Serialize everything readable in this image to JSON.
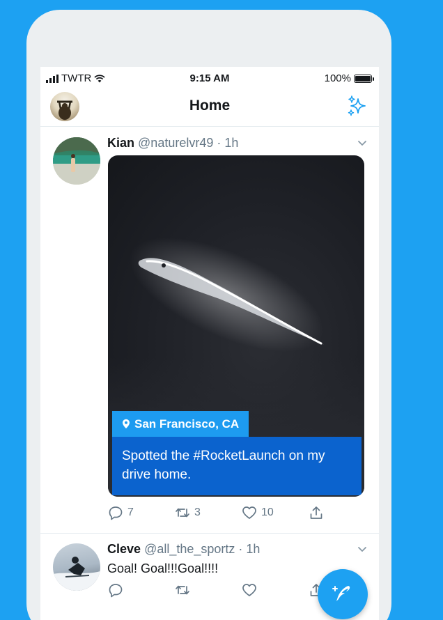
{
  "status_bar": {
    "carrier": "TWTR",
    "time": "9:15 AM",
    "battery": "100%",
    "battery_level": 1.0
  },
  "nav": {
    "title": "Home",
    "left_icon": "profile-avatar",
    "right_icon": "sparkle-icon"
  },
  "tweets": [
    {
      "name": "Kian",
      "handle": "@naturelvr49",
      "time": "· 1h",
      "location": "San Francisco, CA",
      "caption": "Spotted the #RocketLaunch on my drive home.",
      "replies": "7",
      "retweets": "3",
      "likes": "10"
    },
    {
      "name": "Cleve",
      "handle": "@all_the_sportz",
      "time": "· 1h",
      "text": "Goal! Goal!!!Goal!!!!"
    }
  ],
  "fab": {
    "icon": "compose-tweet-icon"
  },
  "colors": {
    "brand": "#1da1f2",
    "caption_bg": "#0b63ce",
    "secondary_text": "#657786"
  }
}
